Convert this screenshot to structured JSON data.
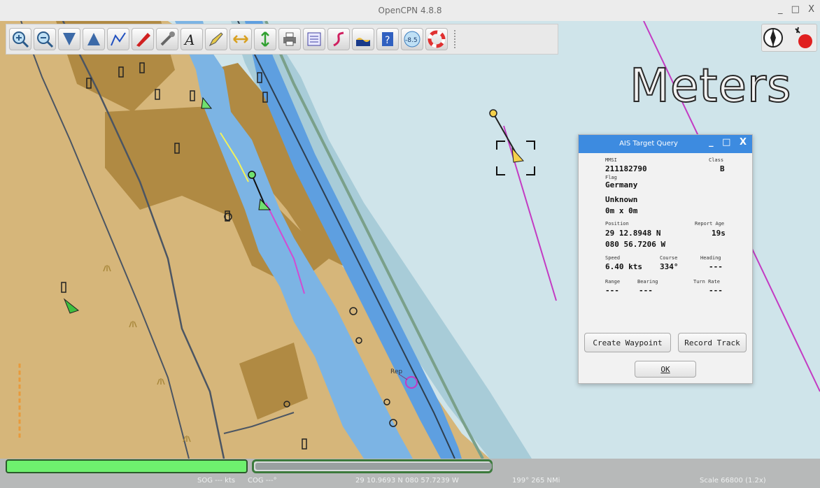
{
  "window": {
    "title": "OpenCPN 4.8.8",
    "controls": [
      "_",
      "□",
      "X"
    ]
  },
  "toolbar": {
    "tools": [
      {
        "name": "zoom-in-icon"
      },
      {
        "name": "zoom-out-icon"
      },
      {
        "name": "scale-in-icon"
      },
      {
        "name": "scale-out-icon"
      },
      {
        "name": "route-icon"
      },
      {
        "name": "ship-icon"
      },
      {
        "name": "settings-wrench-icon"
      },
      {
        "name": "text-icon"
      },
      {
        "name": "pencil-icon"
      },
      {
        "name": "width-icon"
      },
      {
        "name": "height-icon"
      },
      {
        "name": "print-icon"
      },
      {
        "name": "route-manager-icon"
      },
      {
        "name": "track-icon"
      },
      {
        "name": "tide-icon"
      },
      {
        "name": "help-icon"
      },
      {
        "name": "depth-icon",
        "text": "-8.5"
      },
      {
        "name": "mob-icon"
      }
    ]
  },
  "chart": {
    "unit_overlay": "Meters",
    "label_rep": "Rep"
  },
  "ais": {
    "title": "AIS Target Query",
    "controls": [
      "_",
      "□",
      "X"
    ],
    "mmsi_label": "MMSI",
    "mmsi": "211182790",
    "class_label": "Class",
    "class": "B",
    "flag_label": "Flag",
    "flag": "Germany",
    "name": "Unknown",
    "size": "0m x 0m",
    "position_label": "Position",
    "lat": "29 12.8948 N",
    "lon": "080 56.7206 W",
    "report_age_label": "Report Age",
    "report_age": "19s",
    "speed_label": "Speed",
    "speed": "6.40 kts",
    "course_label": "Course",
    "course": "334°",
    "heading_label": "Heading",
    "heading": "---",
    "range_label": "Range",
    "range": "---",
    "bearing_label": "Bearing",
    "bearing": "---",
    "turnrate_label": "Turn Rate",
    "turnrate": "---",
    "create_waypoint": "Create Waypoint",
    "record_track": "Record Track",
    "ok": "OK"
  },
  "status": {
    "sog": "SOG --- kts",
    "cog": "COG ---°",
    "position": "29 10.9693 N 080 57.7239 W",
    "bearing_dist": "199° 265 NMi",
    "scale": "Scale 66800 (1.2x)"
  }
}
